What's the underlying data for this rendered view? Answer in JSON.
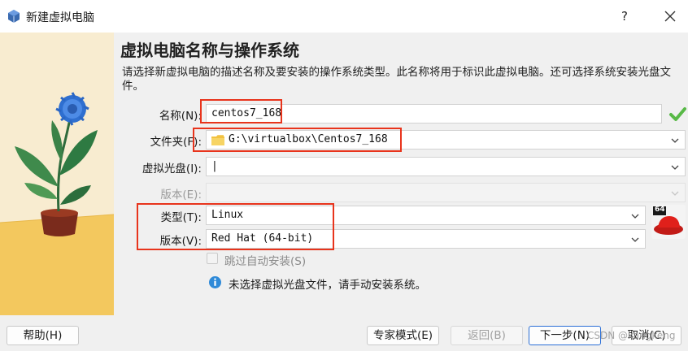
{
  "window": {
    "title": "新建虚拟电脑",
    "help_label": "?",
    "icons": {
      "app": "virtualbox-icon",
      "close": "close-icon"
    }
  },
  "page": {
    "heading": "虚拟电脑名称与操作系统",
    "description": "请选择新虚拟电脑的描述名称及要安装的操作系统类型。此名称将用于标识此虚拟电脑。还可选择系统安装光盘文件。"
  },
  "form": {
    "name": {
      "label": "名称(N):",
      "value": "centos7_168"
    },
    "folder": {
      "label": "文件夹(F):",
      "value": "G:\\virtualbox\\Centos7_168"
    },
    "iso": {
      "label": "虚拟光盘(I):",
      "value": "|"
    },
    "edition": {
      "label": "版本(E):",
      "value": ""
    },
    "type": {
      "label": "类型(T):",
      "value": "Linux"
    },
    "version": {
      "label": "版本(V):",
      "value": "Red Hat (64-bit)"
    },
    "unattended": {
      "label": "跳过自动安装(S)",
      "checked": false
    },
    "info": "未选择虚拟光盘文件，请手动安装系统。",
    "os_icon_badge": "64"
  },
  "buttons": {
    "help": "帮助(H)",
    "expert": "专家模式(E)",
    "back": "返回(B)",
    "next": "下一步(N)",
    "cancel": "取消(C)"
  },
  "watermark": "CSDN @kangkeng",
  "colors": {
    "highlight_box": "#e8341c",
    "primary_border": "#2b6fd6",
    "valid_check": "#58b947"
  }
}
